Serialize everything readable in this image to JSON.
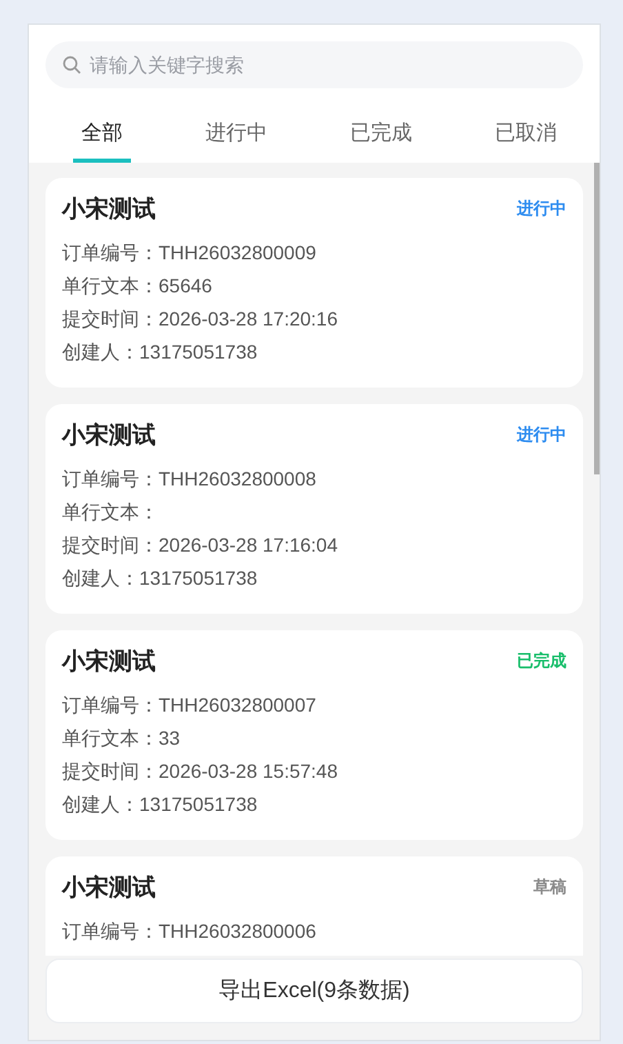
{
  "search": {
    "placeholder": "请输入关键字搜索"
  },
  "tabs": [
    {
      "label": "全部",
      "selected": true
    },
    {
      "label": "进行中",
      "selected": false
    },
    {
      "label": "已完成",
      "selected": false
    },
    {
      "label": "已取消",
      "selected": false
    }
  ],
  "orders": [
    {
      "title": "小宋测试",
      "status": {
        "kind": "in_progress",
        "label": "进行中"
      },
      "fields": [
        {
          "label": "订单编号：",
          "value": "THH26032800009"
        },
        {
          "label": "单行文本：",
          "value": "65646"
        },
        {
          "label": "提交时间：",
          "value": "2026-03-28 17:20:16"
        },
        {
          "label": "创建人：",
          "value": "13175051738"
        }
      ]
    },
    {
      "title": "小宋测试",
      "status": {
        "kind": "in_progress",
        "label": "进行中"
      },
      "fields": [
        {
          "label": "订单编号：",
          "value": "THH26032800008"
        },
        {
          "label": "单行文本："
        },
        {
          "label": "提交时间：",
          "value": "2026-03-28 17:16:04"
        },
        {
          "label": "创建人：",
          "value": "13175051738"
        }
      ]
    },
    {
      "title": "小宋测试",
      "status": {
        "kind": "done",
        "label": "已完成"
      },
      "fields": [
        {
          "label": "订单编号：",
          "value": "THH26032800007"
        },
        {
          "label": "单行文本：",
          "value": "33"
        },
        {
          "label": "提交时间：",
          "value": "2026-03-28 15:57:48"
        },
        {
          "label": "创建人：",
          "value": "13175051738"
        }
      ]
    },
    {
      "title": "小宋测试",
      "status": {
        "kind": "draft",
        "label": "草稿"
      },
      "fields": [
        {
          "label": "订单编号：",
          "value": "THH26032800006"
        }
      ]
    }
  ],
  "export_button": "导出Excel(9条数据)"
}
